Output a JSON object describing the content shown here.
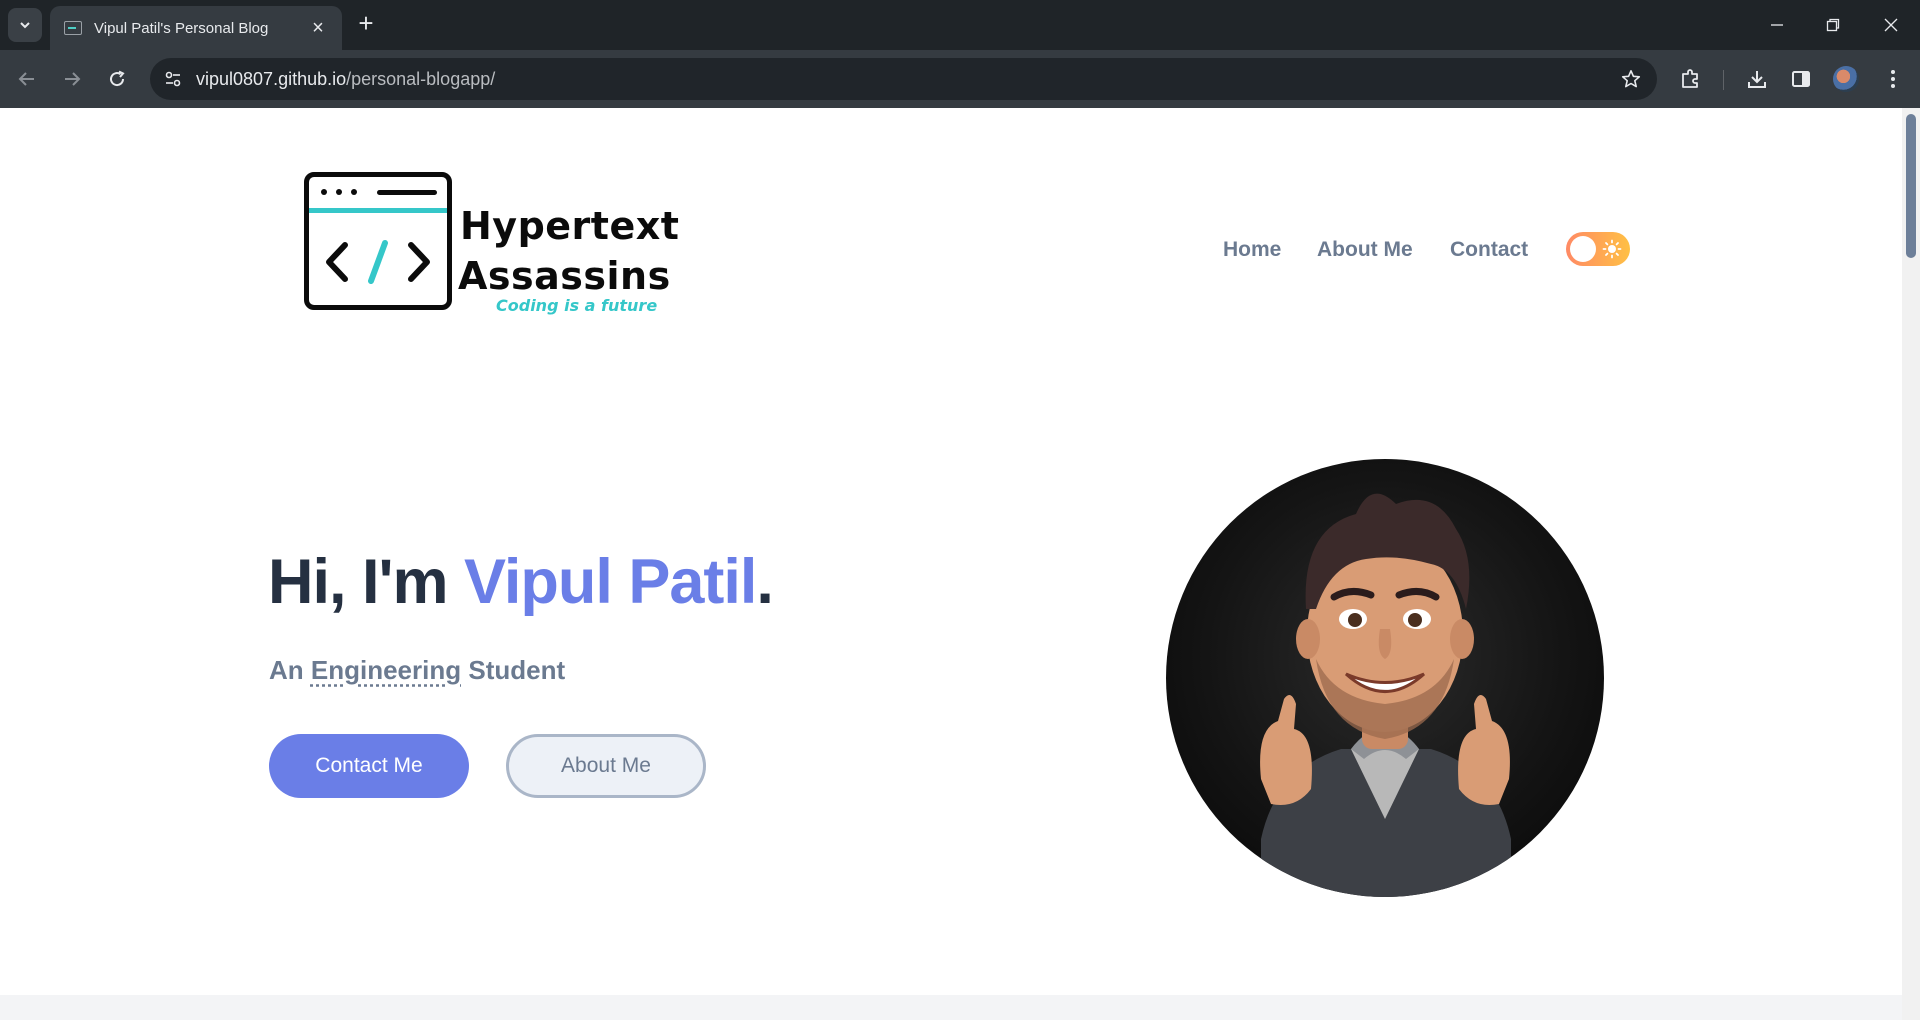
{
  "browser": {
    "tab_title": "Vipul Patil's Personal Blog",
    "url_host": "vipul0807.github.io",
    "url_path": "/personal-blogapp/"
  },
  "site": {
    "logo": {
      "line1": "Hypertext",
      "line2": "Assassins",
      "tagline": "Coding is a future"
    },
    "nav": {
      "home": "Home",
      "about": "About Me",
      "contact": "Contact"
    },
    "hero": {
      "greeting": "Hi, I'm ",
      "name": "Vipul Patil",
      "period": ".",
      "sub_prefix": "An ",
      "sub_emph": "Engineering",
      "sub_suffix": " Student",
      "primary_button": "Contact Me",
      "secondary_button": "About Me"
    }
  },
  "colors": {
    "accent": "#6a7ee7",
    "heading": "#253041",
    "muted": "#6b7a90",
    "logo_teal": "#35c7c9"
  }
}
